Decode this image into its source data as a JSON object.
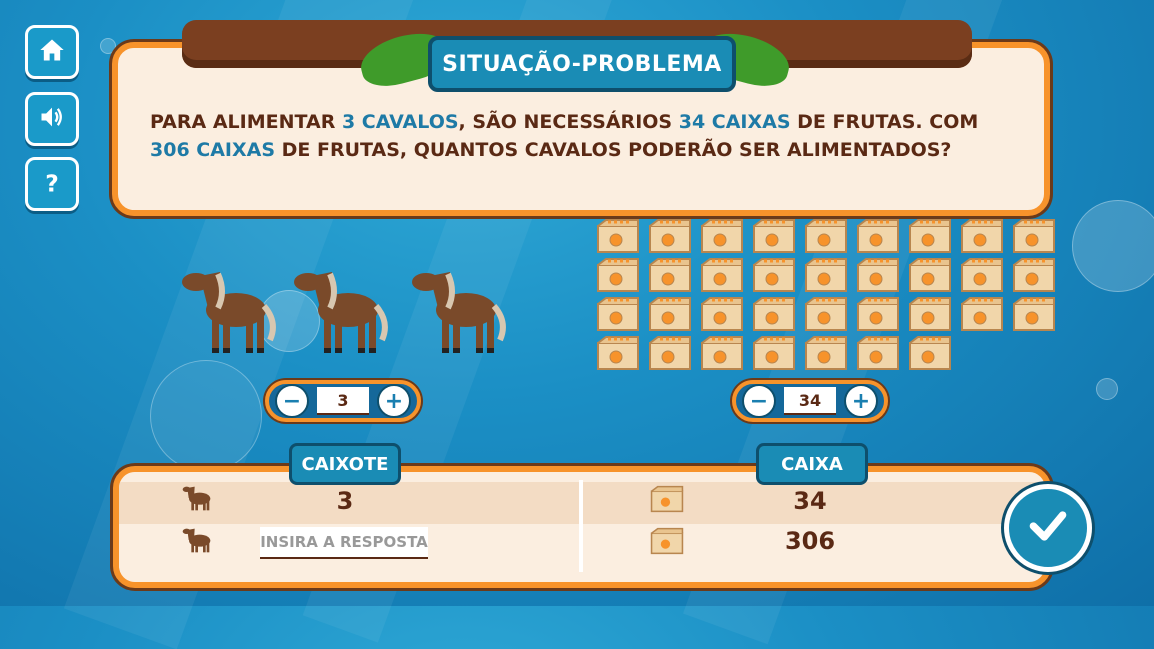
{
  "nav": {
    "home_icon": "home-icon",
    "sound_icon": "speaker-icon",
    "help_icon": "question-icon"
  },
  "problem": {
    "title": "SITUAÇÃO-PROBLEMA",
    "text_part1": "PARA ALIMENTAR ",
    "highlight1": "3 CAVALOS",
    "text_part2": ", SÃO NECESSÁRIOS ",
    "highlight2": "34 CAIXAS",
    "text_part3": " DE FRUTAS. COM ",
    "highlight3": "306 CAIXAS",
    "text_part4": " DE FRUTAS, QUANTOS CAVALOS PODERÃO SER ALIMENTADOS?"
  },
  "horses": {
    "count": 3,
    "stepper_value": "3"
  },
  "boxes": {
    "count": 34,
    "stepper_value": "34"
  },
  "table": {
    "left_header": "CAIXOTE",
    "right_header": "CAIXA",
    "row1_left": "3",
    "row1_right": "34",
    "row2_placeholder": "INSIRA A RESPOSTA",
    "row2_right": "306"
  },
  "colors": {
    "accent": "#f7932b",
    "primary": "#1a8cb5",
    "text": "#5a2914"
  }
}
